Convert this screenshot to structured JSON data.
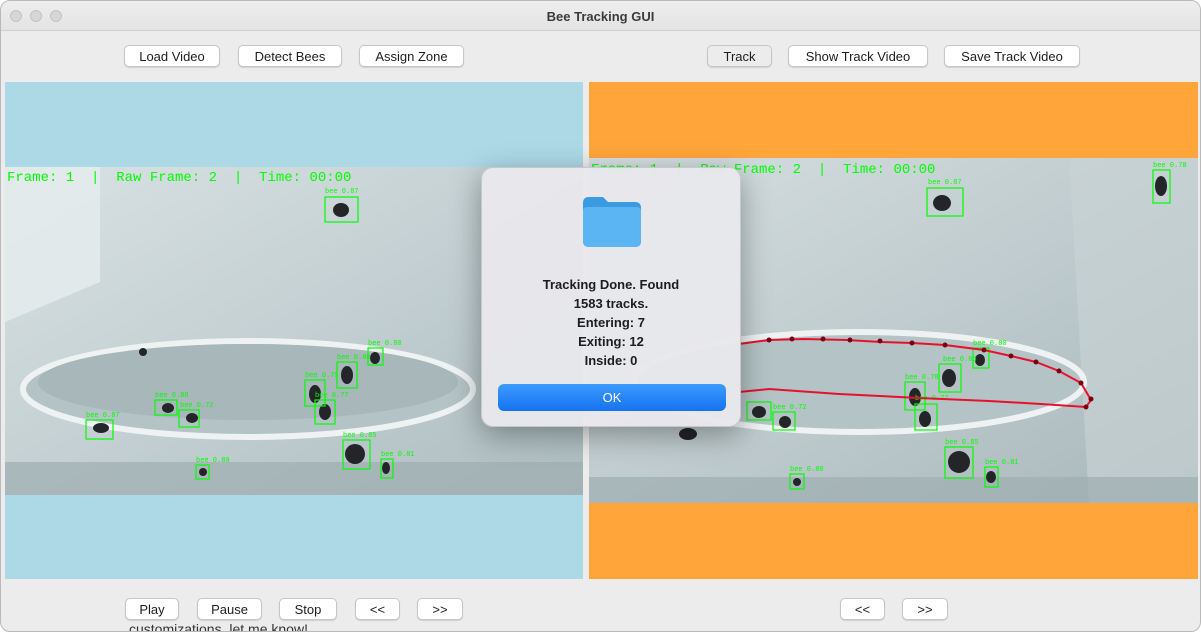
{
  "window": {
    "title": "Bee Tracking GUI"
  },
  "toolbar": {
    "load_video": "Load Video",
    "detect_bees": "Detect Bees",
    "assign_zone": "Assign Zone",
    "track": "Track",
    "show_track_video": "Show Track Video",
    "save_track_video": "Save Track Video"
  },
  "left_view": {
    "overlay": "Frame: 1  |  Raw Frame: 2  |  Time: 00:00",
    "detections": [
      "bee 0.87",
      "bee 0.87",
      "bee 0.88",
      "bee 0.72",
      "bee 0.86",
      "bee 0.75",
      "bee 0.77",
      "bee 0.80",
      "bee 0.85",
      "bee 0.83",
      "bee 0.81",
      "bee 0.80",
      "bee 0.80"
    ]
  },
  "right_view": {
    "overlay": "Frame: 1  |  Raw Frame: 2  |  Time: 00:00",
    "detections": [
      "bee 0.78",
      "bee 0.87",
      "bee 0.80",
      "bee 0.86",
      "bee 0.78",
      "bee 0.77",
      "bee 0.72",
      "bee 0.85",
      "bee 0.81",
      "bee 0.80",
      "bee 0.80"
    ]
  },
  "dialog": {
    "line1": "Tracking Done. Found",
    "line2": "1583 tracks.",
    "line3": "Entering: 7",
    "line4": "Exiting: 12",
    "line5": "Inside: 0",
    "ok_label": "OK"
  },
  "playback": {
    "play": "Play",
    "pause": "Pause",
    "stop": "Stop",
    "prev": "<<",
    "next": ">>",
    "track_prev": "<<",
    "track_next": ">>"
  },
  "background_text": "customizations, let me know!",
  "colors": {
    "left_bg": "#add8e6",
    "right_bg": "#ffa53a",
    "detection_box": "#00ff00",
    "track_line": "#e8112d",
    "ok_button": "#1a7cf5"
  }
}
